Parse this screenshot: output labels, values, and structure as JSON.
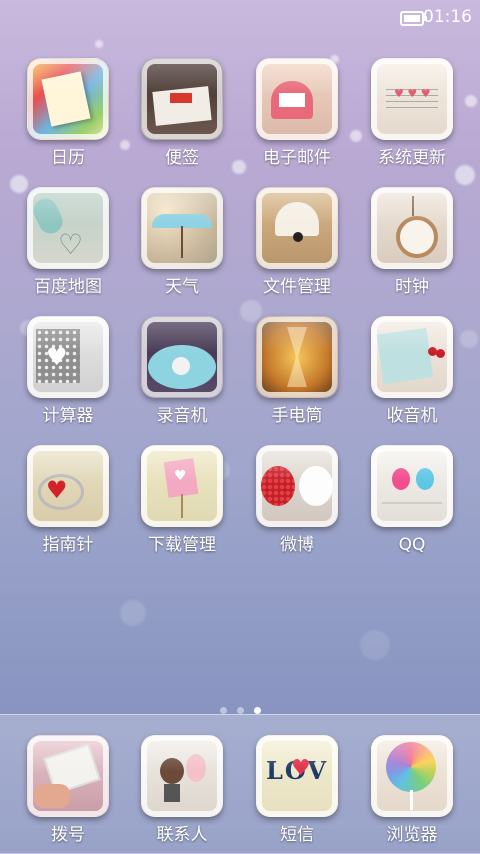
{
  "status_bar": {
    "time": "01:16",
    "battery_icon": "battery-icon"
  },
  "apps": [
    {
      "label": "日历",
      "icon": "calendar-icon"
    },
    {
      "label": "便签",
      "icon": "notes-icon"
    },
    {
      "label": "电子邮件",
      "icon": "mail-icon"
    },
    {
      "label": "系统更新",
      "icon": "update-icon"
    },
    {
      "label": "百度地图",
      "icon": "map-icon"
    },
    {
      "label": "天气",
      "icon": "weather-icon"
    },
    {
      "label": "文件管理",
      "icon": "files-icon"
    },
    {
      "label": "时钟",
      "icon": "clock-icon"
    },
    {
      "label": "计算器",
      "icon": "calculator-icon"
    },
    {
      "label": "录音机",
      "icon": "recorder-icon"
    },
    {
      "label": "手电筒",
      "icon": "flashlight-icon"
    },
    {
      "label": "收音机",
      "icon": "radio-icon"
    },
    {
      "label": "指南针",
      "icon": "compass-icon"
    },
    {
      "label": "下载管理",
      "icon": "downloads-icon"
    },
    {
      "label": "微博",
      "icon": "weibo-icon"
    },
    {
      "label": "QQ",
      "icon": "qq-icon"
    }
  ],
  "page_indicator": {
    "pages": 3,
    "current": 3
  },
  "dock": [
    {
      "label": "拨号",
      "icon": "phone-icon"
    },
    {
      "label": "联系人",
      "icon": "contacts-icon"
    },
    {
      "label": "短信",
      "icon": "sms-icon"
    },
    {
      "label": "浏览器",
      "icon": "browser-icon"
    }
  ],
  "dock_art_text": "LOV"
}
